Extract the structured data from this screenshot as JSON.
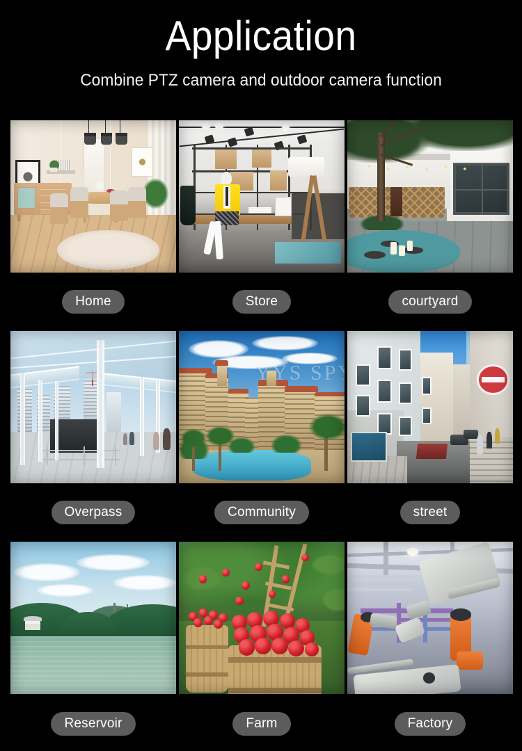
{
  "header": {
    "title": "Application",
    "subtitle": "Combine PTZ camera and outdoor camera function"
  },
  "colors": {
    "background": "#000000",
    "title_text": "#ffffff",
    "subtitle_text": "#f2f2f2",
    "pill_background": "#5c5c5c",
    "pill_text": "#ffffff"
  },
  "watermark": "YYS SPY",
  "grid": {
    "columns": 3,
    "rows": 3,
    "items": [
      {
        "label": "Home",
        "scene": "dining-room-interior"
      },
      {
        "label": "Store",
        "scene": "retail-shop-interior"
      },
      {
        "label": "courtyard",
        "scene": "outdoor-courtyard-patio"
      },
      {
        "label": "Overpass",
        "scene": "glass-pedestrian-overpass"
      },
      {
        "label": "Community",
        "scene": "residential-apartment-complex-pool"
      },
      {
        "label": "street",
        "scene": "narrow-city-street"
      },
      {
        "label": "Reservoir",
        "scene": "lake-and-forested-hills"
      },
      {
        "label": "Farm",
        "scene": "apple-orchard-barrels"
      },
      {
        "label": "Factory",
        "scene": "automotive-robot-assembly-line"
      }
    ]
  }
}
